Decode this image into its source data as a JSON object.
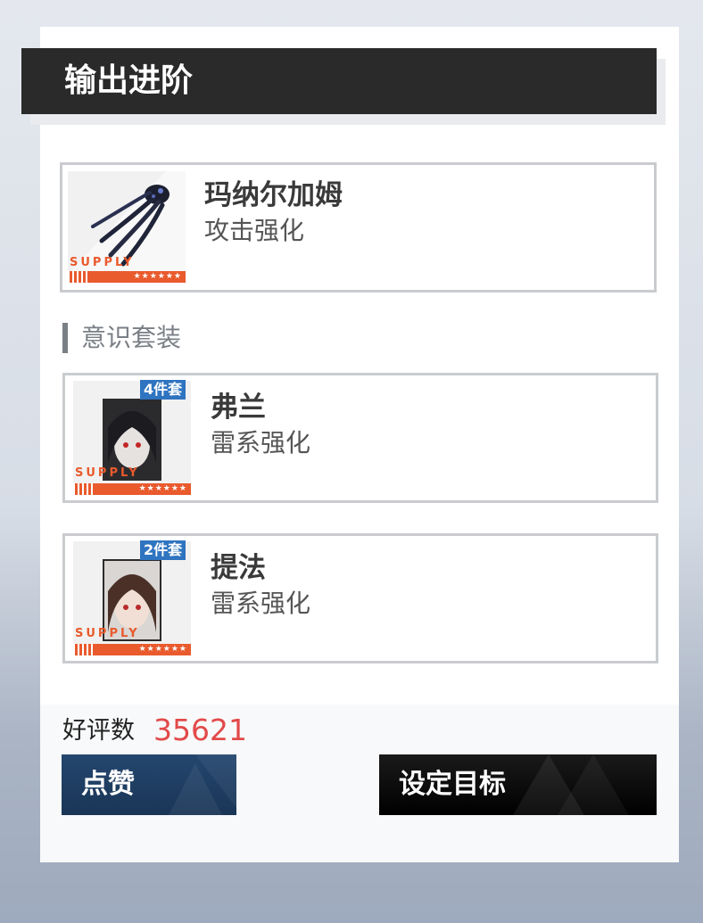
{
  "header": {
    "title": "输出进阶"
  },
  "weapon": {
    "name": "玛纳尔加姆",
    "desc": "攻击强化",
    "supply_label": "SUPPLY",
    "stars": "★★★★★★",
    "icon": "claw-weapon-icon"
  },
  "section": {
    "label": "意识套装"
  },
  "stigmata": [
    {
      "badge": "4件套",
      "name": "弗兰",
      "desc": "雷系强化",
      "supply_label": "SUPPLY",
      "stars": "★★★★★★"
    },
    {
      "badge": "2件套",
      "name": "提法",
      "desc": "雷系强化",
      "supply_label": "SUPPLY",
      "stars": "★★★★★★"
    }
  ],
  "footer": {
    "rating_label": "好评数",
    "rating_value": "35621",
    "like_button": "点赞",
    "target_button": "设定目标"
  },
  "colors": {
    "accent_orange": "#e95a2d",
    "badge_blue": "#2f74c0",
    "rating_red": "#e24a4a",
    "header_dark": "#2a2a2a",
    "like_btn": "#1d3a5e",
    "target_btn": "#0c0c0c"
  }
}
